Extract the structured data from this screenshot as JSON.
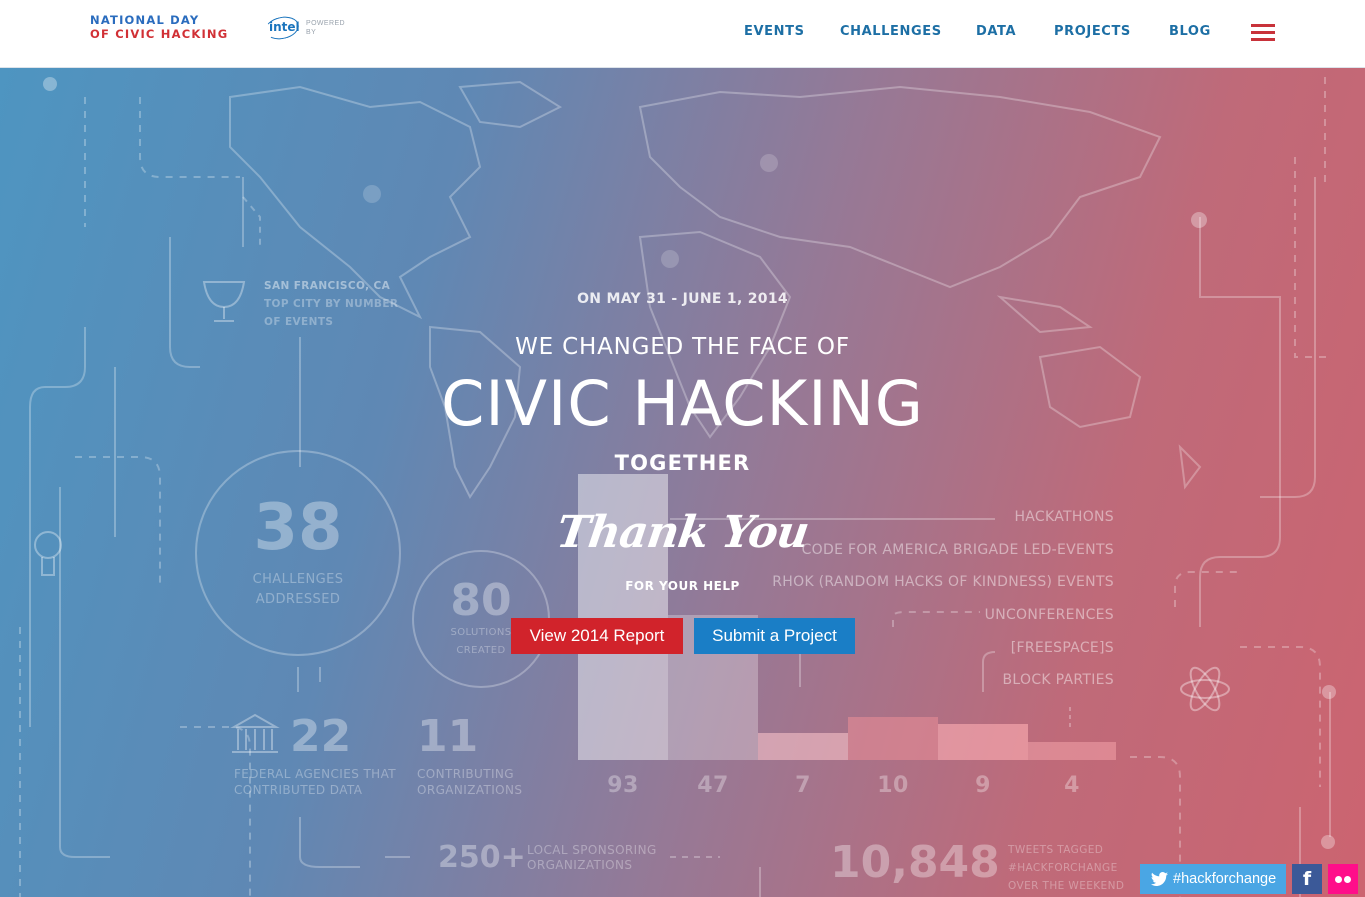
{
  "header": {
    "logo": {
      "line1": "NATIONAL DAY",
      "line2": "OF CIVIC HACKING"
    },
    "sponsor": {
      "word": "intel",
      "powered": "POWERED BY"
    },
    "nav": [
      "EVENTS",
      "CHALLENGES",
      "DATA",
      "PROJECTS",
      "BLOG"
    ],
    "colors": {
      "nav": "#1d6fa5",
      "menu_icon": "#c8323a"
    }
  },
  "hero": {
    "date": "ON MAY 31 - JUNE 1, 2014",
    "pre_heading": "WE CHANGED THE FACE OF",
    "heading": "CIVIC HACKING",
    "post_heading": "TOGETHER",
    "thanks": "Thank You",
    "thanks_sub": "FOR YOUR HELP",
    "buttons": {
      "report": "View 2014 Report",
      "submit": "Submit a Project"
    },
    "colors": {
      "report": "#d1232b",
      "submit": "#1a7ec6"
    }
  },
  "infographic": {
    "city": {
      "name": "SAN FRANCISCO, CA",
      "line1": "TOP CITY BY NUMBER",
      "line2": "OF EVENTS"
    },
    "challenges": {
      "value": "38",
      "line1": "CHALLENGES",
      "line2": "ADDRESSED"
    },
    "solutions": {
      "value": "80",
      "line1": "SOLUTIONS",
      "line2": "CREATED"
    },
    "agencies": {
      "value": "22",
      "line1": "FEDERAL AGENCIES THAT",
      "line2": "CONTRIBUTED DATA"
    },
    "orgs": {
      "value": "11",
      "line1": "CONTRIBUTING",
      "line2": "ORGANIZATIONS"
    },
    "sponsors": {
      "value": "250+",
      "line1": "LOCAL SPONSORING",
      "line2": "ORGANIZATIONS"
    },
    "tweets": {
      "value": "10,848",
      "line1": "TWEETS TAGGED",
      "line2": "#HACKFORCHANGE",
      "line3": "OVER THE WEEKEND"
    },
    "event_types": [
      "HACKATHONS",
      "CODE FOR AMERICA BRIGADE LED-EVENTS",
      "RHOK (RANDOM HACKS OF KINDNESS) EVENTS",
      "UNCONFERENCES",
      "[FREESPACE]S",
      "BLOCK PARTIES"
    ],
    "bar_labels": [
      "93",
      "47",
      "7",
      "10",
      "9",
      "4"
    ]
  },
  "social": {
    "hashtag": "#hackforchange",
    "facebook": "f",
    "colors": {
      "twitter": "#4aa6e4",
      "facebook": "#3b5998",
      "flickr": "#ff0e8a"
    }
  }
}
